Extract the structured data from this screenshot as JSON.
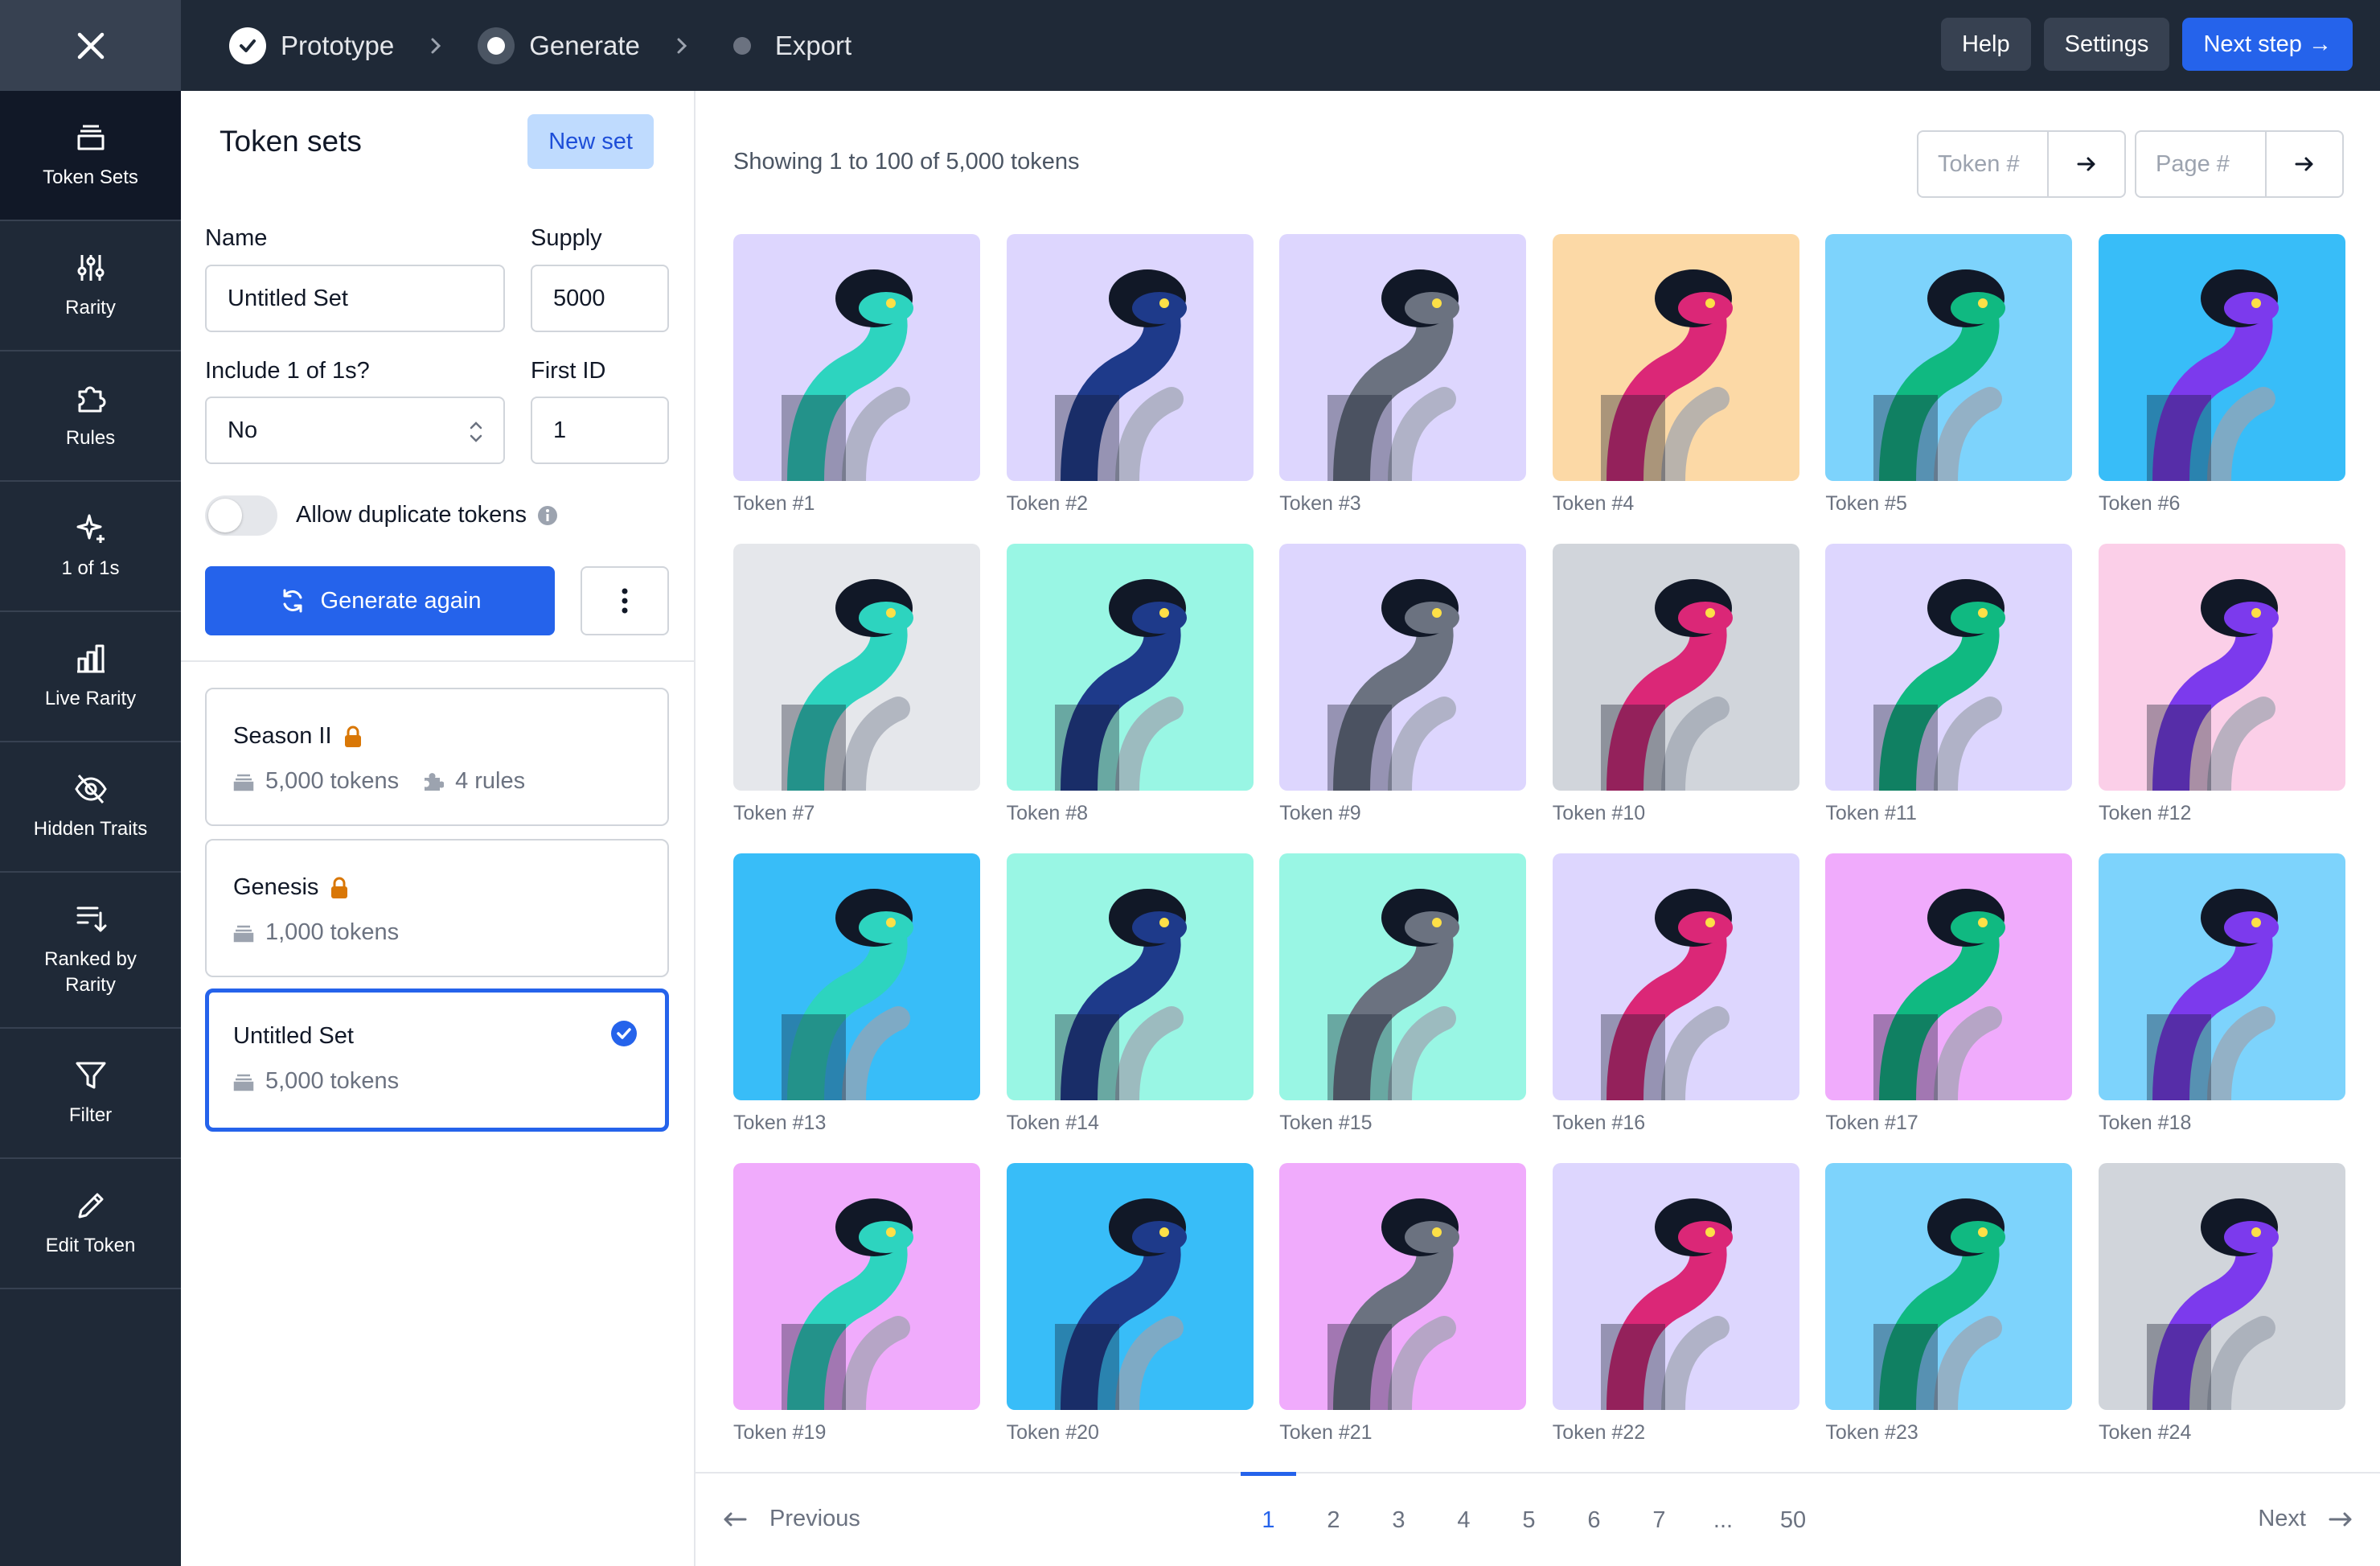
{
  "header": {
    "steps": [
      {
        "label": "Prototype",
        "state": "done"
      },
      {
        "label": "Generate",
        "state": "current"
      },
      {
        "label": "Export",
        "state": "upcoming"
      }
    ],
    "help_label": "Help",
    "settings_label": "Settings",
    "next_label": "Next step →"
  },
  "rail": {
    "items": [
      {
        "label": "Token Sets",
        "icon": "stack-icon"
      },
      {
        "label": "Rarity",
        "icon": "sliders-icon"
      },
      {
        "label": "Rules",
        "icon": "puzzle-icon"
      },
      {
        "label": "1 of 1s",
        "icon": "sparkle-icon"
      },
      {
        "label": "Live Rarity",
        "icon": "bar-chart-icon"
      },
      {
        "label": "Hidden Traits",
        "icon": "eye-off-icon"
      },
      {
        "label": "Ranked by Rarity",
        "icon": "sort-icon"
      },
      {
        "label": "Filter",
        "icon": "filter-icon"
      },
      {
        "label": "Edit Token",
        "icon": "pencil-icon"
      }
    ]
  },
  "panel": {
    "title": "Token sets",
    "new_set_label": "New set",
    "name_label": "Name",
    "name_value": "Untitled Set",
    "supply_label": "Supply",
    "supply_value": "5000",
    "include_label": "Include 1 of 1s?",
    "include_value": "No",
    "first_id_label": "First ID",
    "first_id_value": "1",
    "allow_dup_label": "Allow duplicate tokens",
    "generate_label": "Generate again",
    "sets": [
      {
        "name": "Season II",
        "tokens": "5,000 tokens",
        "rules": "4 rules",
        "locked": true
      },
      {
        "name": "Genesis",
        "tokens": "1,000 tokens",
        "locked": true
      },
      {
        "name": "Untitled Set",
        "tokens": "5,000 tokens",
        "selected": true
      }
    ]
  },
  "content": {
    "showing": "Showing 1 to 100 of 5,000 tokens",
    "token_jump_placeholder": "Token #",
    "page_jump_placeholder": "Page #",
    "tokens": [
      {
        "label": "Token #1",
        "bg": "#ddd6fe"
      },
      {
        "label": "Token #2",
        "bg": "#ddd6fe"
      },
      {
        "label": "Token #3",
        "bg": "#ddd6fe"
      },
      {
        "label": "Token #4",
        "bg": "#fcd9a6"
      },
      {
        "label": "Token #5",
        "bg": "#7dd3fc"
      },
      {
        "label": "Token #6",
        "bg": "#38bdf8"
      },
      {
        "label": "Token #7",
        "bg": "#e5e7eb"
      },
      {
        "label": "Token #8",
        "bg": "#99f6e4"
      },
      {
        "label": "Token #9",
        "bg": "#ddd6fe"
      },
      {
        "label": "Token #10",
        "bg": "#d1d5db"
      },
      {
        "label": "Token #11",
        "bg": "#ddd6fe"
      },
      {
        "label": "Token #12",
        "bg": "#fbcfe8"
      },
      {
        "label": "Token #13",
        "bg": "#38bdf8"
      },
      {
        "label": "Token #14",
        "bg": "#99f6e4"
      },
      {
        "label": "Token #15",
        "bg": "#99f6e4"
      },
      {
        "label": "Token #16",
        "bg": "#ddd6fe"
      },
      {
        "label": "Token #17",
        "bg": "#f0abfc"
      },
      {
        "label": "Token #18",
        "bg": "#7dd3fc"
      },
      {
        "label": "Token #19",
        "bg": "#f0abfc"
      },
      {
        "label": "Token #20",
        "bg": "#38bdf8"
      },
      {
        "label": "Token #21",
        "bg": "#f0abfc"
      },
      {
        "label": "Token #22",
        "bg": "#ddd6fe"
      },
      {
        "label": "Token #23",
        "bg": "#7dd3fc"
      },
      {
        "label": "Token #24",
        "bg": "#d1d5db"
      }
    ],
    "pager": {
      "prev_label": "Previous",
      "next_label": "Next",
      "pages": [
        "1",
        "2",
        "3",
        "4",
        "5",
        "6",
        "7",
        "...",
        "50"
      ],
      "current": "1"
    }
  },
  "colors": {
    "accent": "#2563eb",
    "nav_bg": "#1f2937",
    "lock": "#d97706"
  }
}
